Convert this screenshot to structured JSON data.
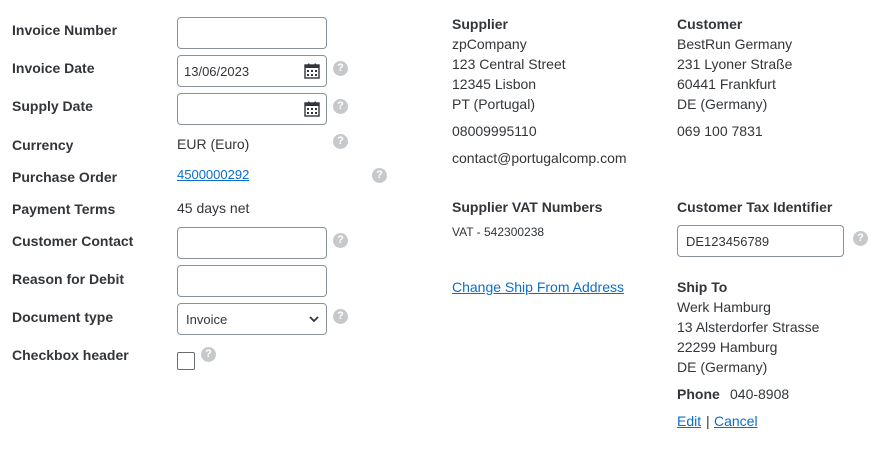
{
  "form": {
    "invoice_number": {
      "label": "Invoice Number",
      "value": ""
    },
    "invoice_date": {
      "label": "Invoice Date",
      "value": "13/06/2023"
    },
    "supply_date": {
      "label": "Supply Date",
      "value": ""
    },
    "currency": {
      "label": "Currency",
      "value": "EUR (Euro)"
    },
    "purchase_order": {
      "label": "Purchase Order",
      "value": "4500000292"
    },
    "payment_terms": {
      "label": "Payment Terms",
      "value": "45 days net"
    },
    "customer_contact": {
      "label": "Customer Contact",
      "value": ""
    },
    "reason_for_debit": {
      "label": "Reason for Debit",
      "value": ""
    },
    "document_type": {
      "label": "Document type",
      "value": "Invoice"
    },
    "checkbox_header": {
      "label": "Checkbox header",
      "checked": false
    }
  },
  "help_glyph": "?",
  "supplier": {
    "heading": "Supplier",
    "name": "zpCompany",
    "street": "123 Central Street",
    "city": "12345 Lisbon",
    "country": "PT (Portugal)",
    "phone": "08009995110",
    "email": "contact@portugalcomp.com",
    "vat_heading": "Supplier VAT Numbers",
    "vat_value": "VAT - 542300238",
    "change_link": "Change Ship From Address"
  },
  "customer": {
    "heading": "Customer",
    "name": "BestRun Germany",
    "street": "231 Lyoner Straße",
    "city": "60441 Frankfurt",
    "country": "DE (Germany)",
    "phone": "069 100 7831",
    "tax_heading": "Customer Tax Identifier",
    "tax_value": "DE123456789"
  },
  "ship_to": {
    "heading": "Ship To",
    "name": "Werk Hamburg",
    "street": "13 Alsterdorfer Strasse",
    "city": "22299 Hamburg",
    "country": "DE (Germany)",
    "phone_label": "Phone",
    "phone_value": "040-8908",
    "edit_link": "Edit",
    "separator": "|",
    "cancel_link": "Cancel"
  }
}
